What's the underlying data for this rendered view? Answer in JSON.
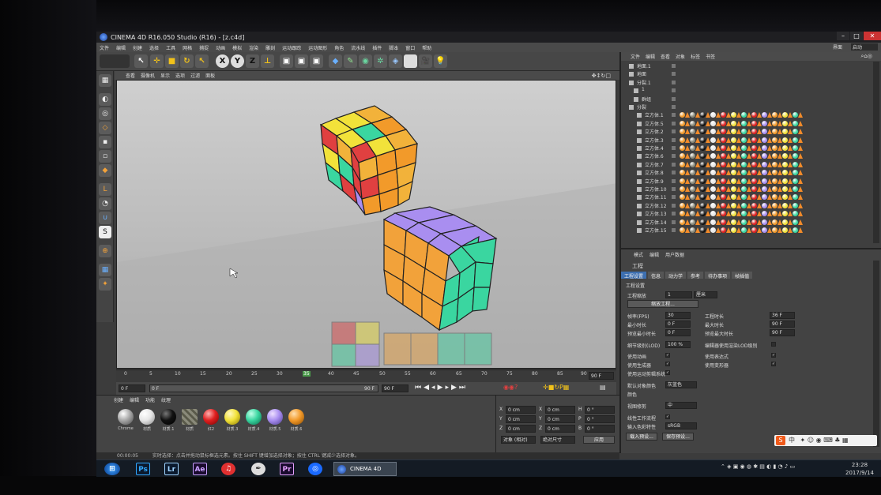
{
  "window": {
    "title": "CINEMA 4D R16.050 Studio (R16) - [z.c4d]"
  },
  "menus": [
    "文件",
    "编辑",
    "创建",
    "选择",
    "工具",
    "网格",
    "捕捉",
    "动画",
    "模拟",
    "渲染",
    "雕刻",
    "运动跟踪",
    "运动图形",
    "角色",
    "流水线",
    "插件",
    "脚本",
    "窗口",
    "帮助"
  ],
  "layout_label": "界面",
  "layout_value": "启动",
  "viewport_menu": [
    "查看",
    "摄像机",
    "显示",
    "选项",
    "过滤",
    "面板"
  ],
  "timeline": {
    "ticks": [
      "0",
      "5",
      "10",
      "15",
      "20",
      "25",
      "30",
      "35",
      "40",
      "45",
      "50",
      "55",
      "60",
      "65",
      "70",
      "75",
      "80",
      "85",
      "90"
    ],
    "current_frame": "35",
    "end_label": "90 F",
    "start_field": "0 F",
    "range_start": "0 F",
    "range_end": "90 F",
    "range_end2": "90 F"
  },
  "material_menu": [
    "创建",
    "编辑",
    "功能",
    "纹理"
  ],
  "materials": [
    {
      "label": "Chrome",
      "color": "#a8a8a8"
    },
    {
      "label": "材质",
      "color": "#e6e6e6"
    },
    {
      "label": "材质.1",
      "color": "#111111"
    },
    {
      "label": "材质",
      "color": "#8a8a7a"
    },
    {
      "label": "红2",
      "color": "#e02020"
    },
    {
      "label": "材质.3",
      "color": "#f2e23a"
    },
    {
      "label": "材质.4",
      "color": "#3ad6a0"
    },
    {
      "label": "材质.5",
      "color": "#a98ef0"
    },
    {
      "label": "材质.6",
      "color": "#f29a2a"
    }
  ],
  "coords": {
    "x": "0 cm",
    "y": "0 cm",
    "z": "0 cm",
    "x2": "0 cm",
    "y2": "0 cm",
    "z2": "0 cm",
    "h": "0 °",
    "p": "0 °",
    "b": "0 °",
    "mode": "对象 (相对)",
    "size_mode": "绝对尺寸",
    "apply": "应用"
  },
  "status": {
    "time": "00:00:05",
    "message": "实时选择：点击并拖动鼠标框选元素。按住 SHIFT 键增加选择对象；按住 CTRL 键减少选择对象。"
  },
  "object_menu": [
    "文件",
    "编辑",
    "查看",
    "对象",
    "标签",
    "书签"
  ],
  "objects": [
    {
      "name": "地面.1"
    },
    {
      "name": "地面"
    },
    {
      "name": "分裂.1"
    },
    {
      "name": "1"
    },
    {
      "name": "群组"
    },
    {
      "name": "分裂"
    },
    {
      "name": "立方体.1"
    },
    {
      "name": "立方体.5"
    },
    {
      "name": "立方体.2"
    },
    {
      "name": "立方体.3"
    },
    {
      "name": "立方体.4"
    },
    {
      "name": "立方体.6"
    },
    {
      "name": "立方体.7"
    },
    {
      "name": "立方体.8"
    },
    {
      "name": "立方体.9"
    },
    {
      "name": "立方体.10"
    },
    {
      "name": "立方体.11"
    },
    {
      "name": "立方体.12"
    },
    {
      "name": "立方体.13"
    },
    {
      "name": "立方体.14"
    },
    {
      "name": "立方体.15"
    }
  ],
  "tag_colors": [
    "#f29a2a",
    "#8a8a7a",
    "#111111",
    "#e6e6e6",
    "#e02020",
    "#f2e23a",
    "#3ad6a0",
    "#e02020",
    "#a98ef0",
    "#f29a2a",
    "#f2e23a",
    "#3ad6a0"
  ],
  "attr_menu": [
    "模式",
    "编辑",
    "用户数据"
  ],
  "attr": {
    "title": "工程",
    "tabs": [
      "工程设置",
      "信息",
      "动力学",
      "参考",
      "待办事项",
      "帧插值"
    ],
    "section": "工程设置",
    "scale_label": "工程缩放",
    "scale_value": "1",
    "scale_unit": "厘米",
    "scale_btn": "缩放工程...",
    "fps_label": "帧率(FPS)",
    "fps_value": "30",
    "proj_time_label": "工程时长",
    "proj_time_value": "36 F",
    "min_time_label": "最小时长",
    "min_time_value": "0 F",
    "max_time_label": "最大时长",
    "max_time_value": "90 F",
    "prev_min_label": "预览最小时长",
    "prev_min_value": "0 F",
    "prev_max_label": "预览最大时长",
    "prev_max_value": "90 F",
    "lod_label": "细节级别(LOD)",
    "lod_value": "100 %",
    "lod_render_label": "编辑器使用渲染LOD级别",
    "use_anim": "使用动画",
    "use_expr": "使用表达式",
    "use_gen": "使用生成器",
    "use_deform": "使用变形器",
    "use_motion": "使用运动剪辑系统",
    "default_color_label": "默认对象颜色",
    "default_color_value": "灰蓝色",
    "color_label": "颜色",
    "view_clip_label": "视图修剪",
    "view_clip_value": "中",
    "linear_label": "线性工作流程",
    "input_color_label": "输入色彩特性",
    "input_color_value": "sRGB",
    "load_preset": "载入预设...",
    "save_preset": "保存预设..."
  },
  "taskbar": {
    "apps": [
      "Ps",
      "Lr",
      "Ae",
      "Pr"
    ],
    "active": "CINEMA 4D",
    "clock_time": "23:28",
    "clock_date": "2017/9/14",
    "ime": "中"
  }
}
